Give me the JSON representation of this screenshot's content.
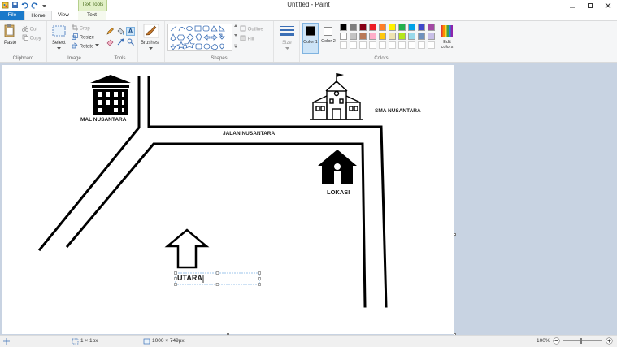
{
  "window": {
    "title": "Untitled - Paint",
    "context_tab": "Text Tools"
  },
  "tabs": {
    "file": "File",
    "home": "Home",
    "view": "View",
    "text": "Text"
  },
  "ribbon": {
    "clipboard": {
      "label": "Clipboard",
      "paste": "Paste",
      "cut": "Cut",
      "copy": "Copy"
    },
    "image": {
      "label": "Image",
      "select": "Select",
      "crop": "Crop",
      "resize": "Resize",
      "rotate": "Rotate"
    },
    "tools": {
      "label": "Tools"
    },
    "brushes": {
      "label": "Brushes"
    },
    "shapes": {
      "label": "Shapes",
      "outline": "Outline",
      "fill": "Fill"
    },
    "size": {
      "label": "Size"
    },
    "colors": {
      "label": "Colors",
      "color1": "Color 1",
      "color2": "Color 2",
      "edit_colors": "Edit colors",
      "palette_row1": [
        "#000000",
        "#7f7f7f",
        "#880015",
        "#ed1c24",
        "#ff7f27",
        "#fff200",
        "#22b14c",
        "#00a2e8",
        "#3f48cc",
        "#a349a4"
      ],
      "palette_row2": [
        "#ffffff",
        "#c3c3c3",
        "#b97a57",
        "#ffaec9",
        "#ffc90e",
        "#efe4b0",
        "#b5e61d",
        "#99d9ea",
        "#7092be",
        "#c8bfe7"
      ]
    }
  },
  "drawing": {
    "mall_label": "MAL NUSANTARA",
    "school_label": "SMA NUSANTARA",
    "road_label": "JALAN NUSANTARA",
    "location_label": "LOKASI",
    "north_label": "UTARA"
  },
  "status": {
    "selection_size": "1 × 1px",
    "canvas_size": "1000 × 749px",
    "zoom": "100%"
  }
}
